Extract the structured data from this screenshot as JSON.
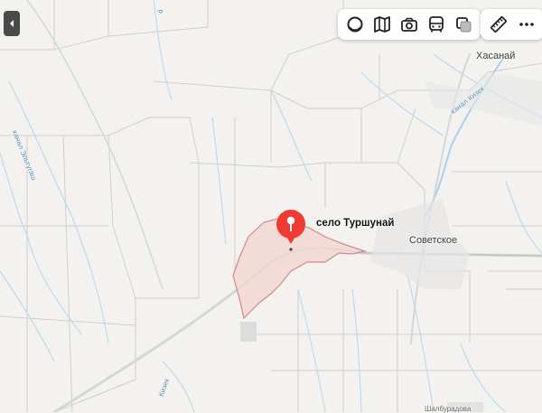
{
  "place": {
    "title": "село Туршунай"
  },
  "labels": {
    "village_khasanai": "Хасанай",
    "village_sovetskoe": "Советское",
    "canal_kiziek": "канал Кизек",
    "canal_kiziek_bottom": "Кизек",
    "canal_eltugash": "канал Эльтугаш",
    "street_bottom": "Шалбурадова",
    "river_top": "р"
  },
  "colors": {
    "land": "#f3f2ef",
    "field_border": "#c9c9c9",
    "water_line": "#b9dcf0",
    "main_road": "#cfcfcf",
    "territory_fill": "#f2d4d2",
    "territory_border": "#d58888",
    "pin": "#ef3b32"
  },
  "controls": {
    "collapse_icon": "chevron-left-icon",
    "layers_icon": "circle-layers-icon",
    "map_icon": "book-map-icon",
    "photo_icon": "camera-icon",
    "transit_icon": "bus-icon",
    "panorama_icon": "panorama-icon",
    "ruler_icon": "ruler-icon",
    "more_icon": "more-dots-icon"
  }
}
